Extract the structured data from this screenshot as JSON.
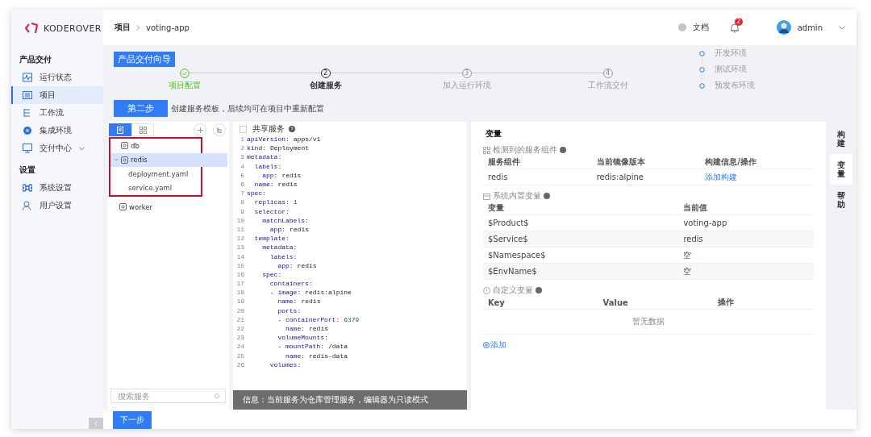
{
  "sidebar": {
    "logo": "KODEROVER",
    "sections": [
      {
        "title": "产品交付",
        "items": [
          {
            "label": "运行状态",
            "selected": false
          },
          {
            "label": "项目",
            "selected": true
          },
          {
            "label": "工作流",
            "selected": false
          },
          {
            "label": "集成环境",
            "selected": false
          },
          {
            "label": "交付中心",
            "selected": false,
            "has_caret": true
          }
        ]
      },
      {
        "title": "设置",
        "items": [
          {
            "label": "系统设置",
            "selected": false
          },
          {
            "label": "用户设置",
            "selected": false
          }
        ]
      }
    ]
  },
  "header": {
    "breadcrumb": [
      "项目",
      "voting-app"
    ],
    "docs": "文档",
    "notifications": "2",
    "user": "admin"
  },
  "wizard": {
    "title": "产品交付向导",
    "steps": [
      {
        "label": "项目配置",
        "completed": true,
        "selected": false
      },
      {
        "num": "2",
        "label": "创建服务",
        "completed": false,
        "selected": true
      },
      {
        "num": "3",
        "label": "加入运行环境",
        "completed": false,
        "selected": false
      },
      {
        "num": "4",
        "label": "工作流交付",
        "completed": false,
        "selected": false
      }
    ],
    "environments": [
      "开发环境",
      "测试环境",
      "预发布环境"
    ],
    "step_badge": "第二步",
    "step_hint": "创建服务模板，后续均可在项目中重新配置"
  },
  "service_tree": {
    "tabs": [
      {
        "selected": true
      },
      {
        "selected": false
      }
    ],
    "items": [
      {
        "label": "db",
        "framed": true,
        "selected": false,
        "expanded": false
      },
      {
        "label": "redis",
        "framed": true,
        "selected": true,
        "expanded": true,
        "children": [
          {
            "label": "deployment.yaml"
          },
          {
            "label": "service.yaml"
          }
        ]
      },
      {
        "label": "worker",
        "framed": false,
        "selected": false,
        "expanded": false
      }
    ],
    "search": {
      "placeholder": "搜索服务"
    }
  },
  "editor": {
    "shared_label": "共享服务",
    "shared_checked": false,
    "lines": [
      {
        "n": "1",
        "key": "apiVersion:",
        "value": "apps/v1"
      },
      {
        "n": "2",
        "key": "kind:",
        "value": "Deployment"
      },
      {
        "n": "3",
        "key": "metadata:"
      },
      {
        "n": "4",
        "key": "  labels:"
      },
      {
        "n": "5",
        "key": "    app:",
        "value": "redis"
      },
      {
        "n": "6",
        "key": "  name:",
        "value": "redis"
      },
      {
        "n": "7",
        "key": "spec:"
      },
      {
        "n": "8",
        "key": "  replicas:",
        "value": "1",
        "numeric": true
      },
      {
        "n": "9",
        "key": "  selector:"
      },
      {
        "n": "10",
        "key": "    matchLabels:"
      },
      {
        "n": "11",
        "key": "      app:",
        "value": "redis"
      },
      {
        "n": "12",
        "key": "  template:"
      },
      {
        "n": "13",
        "key": "    metadata:"
      },
      {
        "n": "14",
        "key": "      labels:"
      },
      {
        "n": "15",
        "key": "        app:",
        "value": "redis"
      },
      {
        "n": "16",
        "key": "    spec:"
      },
      {
        "n": "17",
        "key": "      containers:"
      },
      {
        "n": "18",
        "key": "      - image:",
        "value": "redis:alpine"
      },
      {
        "n": "19",
        "key": "        name:",
        "value": "redis"
      },
      {
        "n": "20",
        "key": "        ports:"
      },
      {
        "n": "21",
        "key": "        - containerPort:",
        "value": "6379",
        "numeric": true
      },
      {
        "n": "22",
        "key": "          name:",
        "value": "redis"
      },
      {
        "n": "23",
        "key": "        volumeMounts:"
      },
      {
        "n": "24",
        "key": "        - mountPath:",
        "value": "/data"
      },
      {
        "n": "25",
        "key": "          name:",
        "value": "redis-data"
      },
      {
        "n": "26",
        "key": "      volumes:"
      }
    ],
    "info": "信息：当前服务为仓库管理服务，编辑器为只读模式"
  },
  "variables": {
    "title": "变量",
    "detected": {
      "title": "检测到的服务组件",
      "columns": [
        "服务组件",
        "当前镜像版本",
        "构建信息/操作"
      ],
      "rows": [
        {
          "service": "redis",
          "image": "redis:alpine",
          "action": "添加构建"
        }
      ]
    },
    "builtin": {
      "title": "系统内置变量",
      "columns": [
        "变量",
        "当前值"
      ],
      "rows": [
        [
          "$Product$",
          "voting-app"
        ],
        [
          "$Service$",
          "redis"
        ],
        [
          "$Namespace$",
          "空"
        ],
        [
          "$EnvName$",
          "空"
        ]
      ]
    },
    "custom": {
      "title": "自定义变量",
      "columns": [
        "Key",
        "Value",
        "操作"
      ],
      "empty": "暂无数据",
      "add": "添加"
    }
  },
  "side_tabs": [
    {
      "label": "构建",
      "selected": false
    },
    {
      "label": "变量",
      "selected": true
    },
    {
      "label": "帮助",
      "selected": false
    }
  ],
  "footer": {
    "next": "下一步"
  }
}
